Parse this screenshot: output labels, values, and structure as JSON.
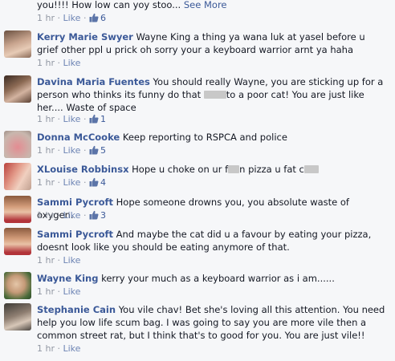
{
  "top_comment": {
    "text": "you!!!! How low can yoy stoo...",
    "see_more": "See More",
    "time": "1 hr",
    "like_label": "Like",
    "like_count": "6"
  },
  "comments": [
    {
      "author": "Kerry Marie Swyer",
      "text": "Wayne King a thing ya wana luk at yasel before u grief other ppl u prick oh sorry your a keyboard warrior arnt ya haha",
      "time": "1 hr",
      "like_label": "Like",
      "like_count": ""
    },
    {
      "author": "Davina Maria Fuentes",
      "text_a": "You should really Wayne, you are sticking up for a person who thinks its funny do that",
      "text_b": "to a poor cat! You are just like her.... Waste of space",
      "time": "1 hr",
      "like_label": "Like",
      "like_count": "1"
    },
    {
      "author": "Donna McCooke",
      "text": "Keep reporting to RSPCA and police",
      "time": "1 hr",
      "like_label": "Like",
      "like_count": "5"
    },
    {
      "author": "XLouise Robbinsx",
      "text_a": "Hope u choke on ur f",
      "text_b": "n pizza u fat c",
      "time": "1 hr",
      "like_label": "Like",
      "like_count": "4"
    },
    {
      "author": "Sammi Pycroft",
      "text": "Hope someone drowns you, you absolute waste of oxygen.",
      "time": "1 hr",
      "like_label": "Like",
      "like_count": "3"
    },
    {
      "author": "Sammi Pycroft",
      "text": "And maybe the cat did u a favour by eating your pizza, doesnt look like you should be eating anymore of that.",
      "time": "1 hr",
      "like_label": "Like",
      "like_count": ""
    },
    {
      "author": "Wayne King",
      "text": "kerry your much as a keyboard warrior as i am......",
      "time": "1 hr",
      "like_label": "Like",
      "like_count": ""
    },
    {
      "author": "Stephanie Cain",
      "text": "You vile chav! Bet she's loving all this attention. You need help you low life scum bag. I was going to say you are more vile then a common street rat, but I think that's to good for you. You are just vile!!",
      "time": "1 hr",
      "like_label": "Like",
      "like_count": ""
    }
  ],
  "separator": "·"
}
